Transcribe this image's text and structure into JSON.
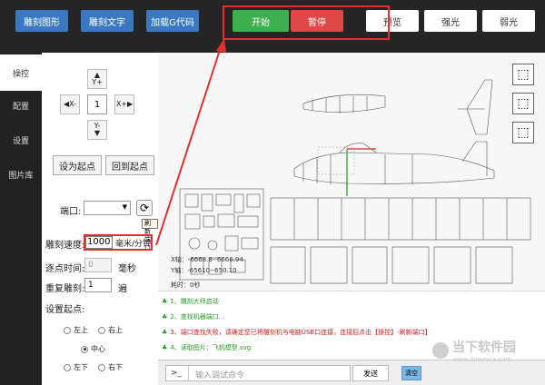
{
  "toolbar": {
    "engrave_shape": "雕刻图形",
    "engrave_text": "雕刻文字",
    "load_gcode": "加载G代码",
    "start": "开始",
    "pause": "暂停",
    "preview": "预览",
    "strong_light": "强光",
    "weak_light": "弱光"
  },
  "sidebar": {
    "items": [
      "操控",
      "配置",
      "设置",
      "图片库"
    ]
  },
  "panel": {
    "step_value": "1",
    "y_plus": "Y+",
    "y_minus": "Y-",
    "x_minus": "X-",
    "x_plus": "X+",
    "set_origin": "设为起点",
    "return_origin": "回到起点",
    "port_label": "端口:",
    "port_value": "",
    "refresh_tooltip": "刷新端口",
    "speed_label": "雕刻速度:",
    "speed_value": "1000",
    "speed_unit": "毫米/分钟",
    "dot_time_label": "逐点时间:",
    "dot_time_value": "0",
    "dot_time_unit": "毫秒",
    "repeat_label": "重复雕刻:",
    "repeat_value": "1",
    "repeat_unit": "遍",
    "origin_label": "设置起点:",
    "origin_options": {
      "top_left": "左上",
      "top_right": "右上",
      "center": "中心",
      "bottom_left": "左下",
      "bottom_right": "右下"
    }
  },
  "canvas": {
    "x_axis": "X轴：-6668.8--6666.94",
    "y_axis": "Y轴：-65610--650.10",
    "time": "耗时：0秒"
  },
  "log": {
    "lines": [
      "1、雕刻大师启动",
      "2、查找机器端口...",
      "3、端口查找失败，请确定您已将雕刻机与电脑USB口连接，连接后点击【操控】-刷新端口】",
      "4、读取图片：飞机模型.svg"
    ]
  },
  "cmd": {
    "prompt": ">_",
    "placeholder": "输入调试命令",
    "send": "发送",
    "clear": "清空"
  },
  "watermark": {
    "brand": "当下软件园",
    "url": "www.downxia.com"
  },
  "colors": {
    "blue": "#3a78c2",
    "green": "#3daf4e",
    "red": "#e04848",
    "callout": "#e03030"
  }
}
